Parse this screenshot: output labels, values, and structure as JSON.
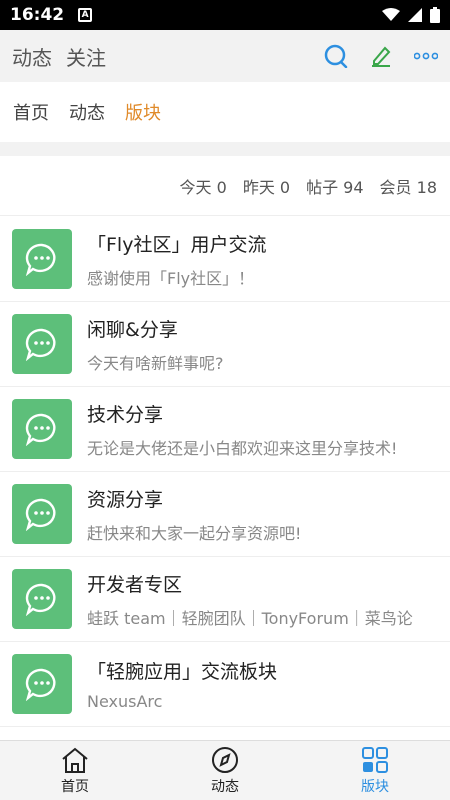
{
  "status": {
    "time": "16:42",
    "notif_icon": "A"
  },
  "topbar": {
    "tabs": [
      "动态",
      "关注"
    ]
  },
  "subnav": {
    "tabs": [
      "首页",
      "动态",
      "版块"
    ],
    "active_index": 2
  },
  "stats": {
    "today": "今天 0",
    "yesterday": "昨天 0",
    "posts": "帖子 94",
    "members": "会员 18"
  },
  "boards": [
    {
      "title": "「Fly社区」用户交流",
      "desc": "感谢使用「Fly社区」！"
    },
    {
      "title": "闲聊&分享",
      "desc": "今天有啥新鲜事呢?"
    },
    {
      "title": "技术分享",
      "desc": "无论是大佬还是小白都欢迎来这里分享技术!"
    },
    {
      "title": "资源分享",
      "desc": "赶快来和大家一起分享资源吧!"
    },
    {
      "title": "开发者专区",
      "desc": "蛙跃 team｜轻腕团队｜TonyForum｜菜鸟论"
    },
    {
      "title": "「轻腕应用」交流板块",
      "desc": "NexusArc"
    }
  ],
  "bottom_nav": [
    {
      "label": "首页",
      "icon": "home-icon"
    },
    {
      "label": "动态",
      "icon": "compass-icon"
    },
    {
      "label": "版块",
      "icon": "grid-icon"
    }
  ],
  "colors": {
    "accent": "#e08a2a",
    "board_icon": "#5dbf7a",
    "active_nav": "#2d8fe0"
  }
}
